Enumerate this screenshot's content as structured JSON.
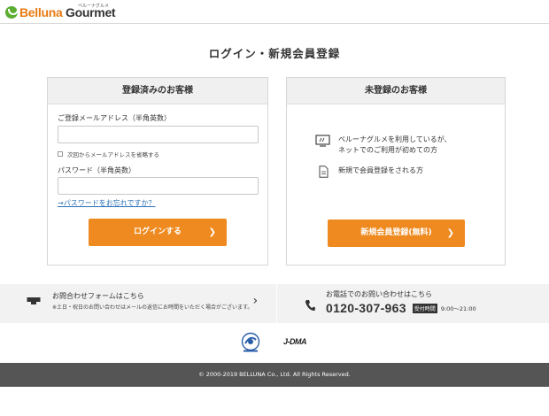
{
  "header": {
    "logo_text_b": "Belluna",
    "logo_text_g": " Gourmet",
    "logo_sub": "ベルーナグルメ"
  },
  "page": {
    "title": "ログイン・新規会員登録"
  },
  "member": {
    "heading": "登録済みのお客様",
    "email_label": "ご登録メールアドレス（半角英数）",
    "email_value": "",
    "remember_label": "次回からメールアドレスを省略する",
    "password_label": "パスワード（半角英数）",
    "password_value": "",
    "forgot_link": "→パスワードをお忘れですか？",
    "login_button": "ログインする"
  },
  "guest": {
    "heading": "未登録のお客様",
    "info1_line1": "ベルーナグルメを利用しているが、",
    "info1_line2": "ネットでのご利用が初めての方",
    "info2": "新規で会員登録をされる方",
    "register_button": "新規会員登録(無料)"
  },
  "contact": {
    "form_title": "お問合わせフォームはこちら",
    "form_note": "※土日・祝日のお問い合わせはメールの返信にお時間をいただく場合がございます。",
    "phone_title": "お電話でのお問い合わせはこちら",
    "phone_number": "0120-307-963",
    "hours_badge": "受付時間",
    "hours": "9:00〜21:00"
  },
  "marks": {
    "jdma": "J-DMA"
  },
  "footer": {
    "copyright": "© 2000-2019 BELLUNA Co., Ltd. All Rights Reserved."
  },
  "colors": {
    "accent": "#ee8a1f",
    "link": "#2a6fb8",
    "footer_bg": "#555555",
    "logo_green": "#5cae32"
  },
  "icons": [
    "pc-icon",
    "document-icon",
    "mail-form-icon",
    "phone-icon",
    "chevron-right-icon",
    "privacy-mark-icon"
  ]
}
